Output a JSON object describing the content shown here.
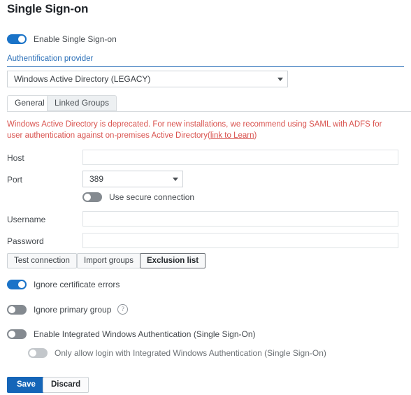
{
  "page": {
    "title": "Single Sign-on"
  },
  "enable_sso": {
    "label": "Enable Single Sign-on",
    "state": "on"
  },
  "provider": {
    "label": "Authentification provider",
    "selected": "Windows Active Directory (LEGACY)"
  },
  "tabs": [
    {
      "label": "General",
      "active": true
    },
    {
      "label": "Linked Groups",
      "active": false
    }
  ],
  "warning": {
    "text_before": "Windows Active Directory is deprecated. For new installations, we recommend using SAML with ADFS for user authentication against on-premises Active Directory(",
    "link_text": "link to Learn",
    "text_after": ")"
  },
  "fields": {
    "host": {
      "label": "Host",
      "value": "",
      "placeholder": ""
    },
    "port": {
      "label": "Port",
      "value": "389"
    },
    "username": {
      "label": "Username",
      "value": "",
      "placeholder": ""
    },
    "password": {
      "label": "Password",
      "value": "",
      "placeholder": ""
    }
  },
  "secure_connection": {
    "label": "Use secure connection",
    "state": "off"
  },
  "buttons": {
    "test_connection": "Test connection",
    "import_groups": "Import groups",
    "exclusion_list": "Exclusion list",
    "save": "Save",
    "discard": "Discard"
  },
  "options": {
    "ignore_cert_errors": {
      "label": "Ignore certificate errors",
      "state": "on"
    },
    "ignore_primary_group": {
      "label": "Ignore primary group",
      "state": "off",
      "help_icon": "?"
    },
    "enable_iwa": {
      "label": "Enable Integrated Windows Authentication (Single Sign-On)",
      "state": "off"
    },
    "only_allow_iwa": {
      "label": "Only allow login with Integrated Windows Authentication (Single Sign-On)",
      "state": "off"
    }
  },
  "colors": {
    "accent": "#1a73c8",
    "primary_button": "#1565b8",
    "warning": "#d9534f",
    "link": "#2a6fb8"
  }
}
